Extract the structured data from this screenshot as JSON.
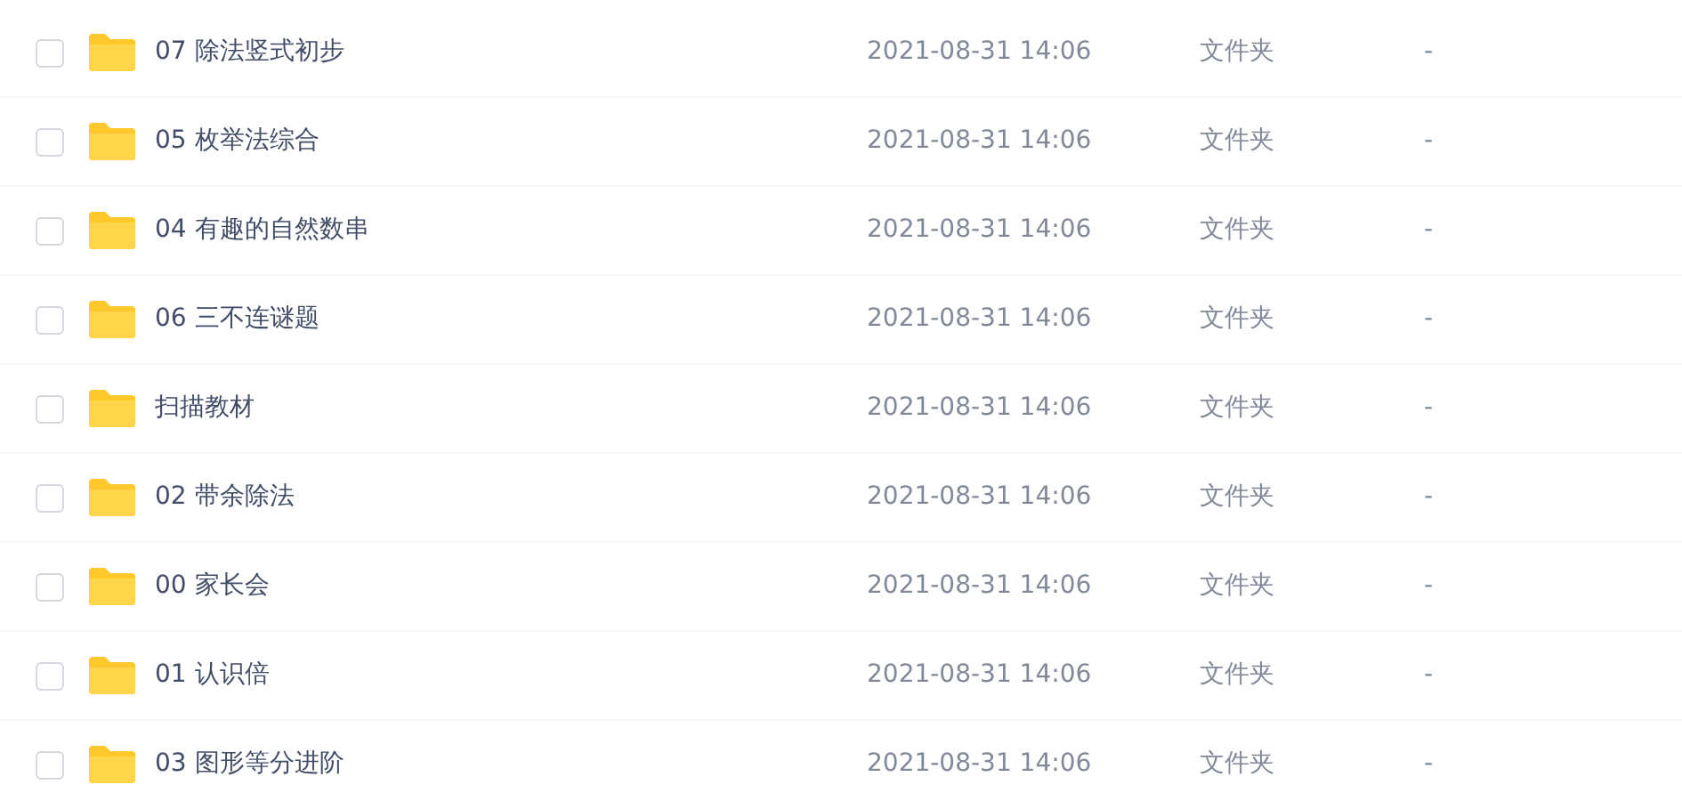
{
  "files": [
    {
      "name": "07 除法竖式初步",
      "modified": "2021-08-31 14:06",
      "type": "文件夹",
      "size": "-",
      "checked": false
    },
    {
      "name": "05 枚举法综合",
      "modified": "2021-08-31 14:06",
      "type": "文件夹",
      "size": "-",
      "checked": false
    },
    {
      "name": "04 有趣的自然数串",
      "modified": "2021-08-31 14:06",
      "type": "文件夹",
      "size": "-",
      "checked": false
    },
    {
      "name": "06 三不连谜题",
      "modified": "2021-08-31 14:06",
      "type": "文件夹",
      "size": "-",
      "checked": false
    },
    {
      "name": "扫描教材",
      "modified": "2021-08-31 14:06",
      "type": "文件夹",
      "size": "-",
      "checked": false
    },
    {
      "name": "02 带余除法",
      "modified": "2021-08-31 14:06",
      "type": "文件夹",
      "size": "-",
      "checked": false
    },
    {
      "name": "00 家长会",
      "modified": "2021-08-31 14:06",
      "type": "文件夹",
      "size": "-",
      "checked": false
    },
    {
      "name": "01 认识倍",
      "modified": "2021-08-31 14:06",
      "type": "文件夹",
      "size": "-",
      "checked": false
    },
    {
      "name": "03 图形等分进阶",
      "modified": "2021-08-31 14:06",
      "type": "文件夹",
      "size": "-",
      "checked": false
    }
  ]
}
